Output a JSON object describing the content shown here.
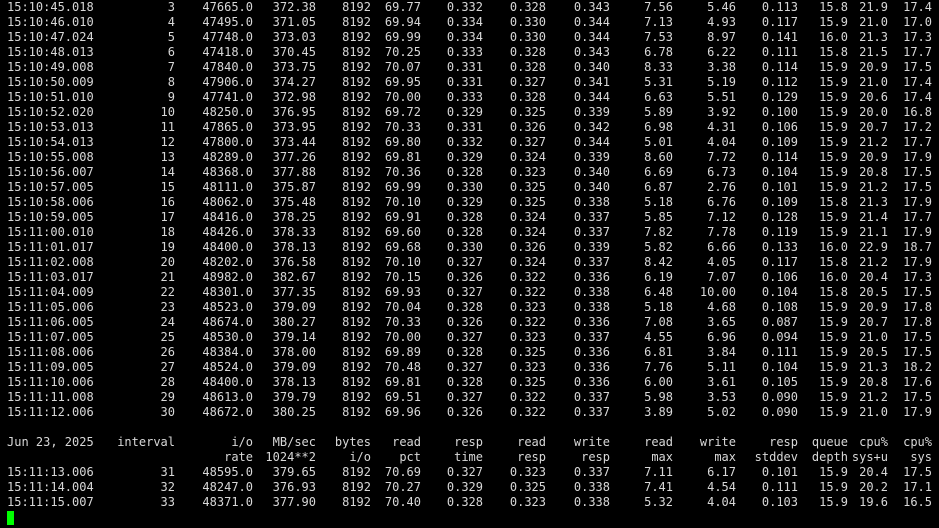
{
  "terminal": {
    "background": "#000000",
    "foreground": "#d8d8d8",
    "cursor_color": "#00ff00"
  },
  "block1": [
    [
      "15:10:45.018",
      "3",
      "47665.0",
      "372.38",
      "8192",
      "69.77",
      "0.332",
      "0.328",
      "0.343",
      "7.56",
      "5.46",
      "0.113",
      "15.8",
      "21.9",
      "17.4"
    ],
    [
      "15:10:46.010",
      "4",
      "47495.0",
      "371.05",
      "8192",
      "69.94",
      "0.334",
      "0.330",
      "0.344",
      "7.13",
      "4.93",
      "0.117",
      "15.9",
      "21.0",
      "17.0"
    ],
    [
      "15:10:47.024",
      "5",
      "47748.0",
      "373.03",
      "8192",
      "69.99",
      "0.334",
      "0.330",
      "0.344",
      "7.53",
      "8.97",
      "0.141",
      "16.0",
      "21.3",
      "17.3"
    ],
    [
      "15:10:48.013",
      "6",
      "47418.0",
      "370.45",
      "8192",
      "70.25",
      "0.333",
      "0.328",
      "0.343",
      "6.78",
      "6.22",
      "0.111",
      "15.8",
      "21.5",
      "17.7"
    ],
    [
      "15:10:49.008",
      "7",
      "47840.0",
      "373.75",
      "8192",
      "70.07",
      "0.331",
      "0.328",
      "0.340",
      "8.33",
      "3.38",
      "0.114",
      "15.9",
      "20.9",
      "17.5"
    ],
    [
      "15:10:50.009",
      "8",
      "47906.0",
      "374.27",
      "8192",
      "69.95",
      "0.331",
      "0.327",
      "0.341",
      "5.31",
      "5.19",
      "0.112",
      "15.9",
      "21.0",
      "17.4"
    ],
    [
      "15:10:51.010",
      "9",
      "47741.0",
      "372.98",
      "8192",
      "70.00",
      "0.333",
      "0.328",
      "0.344",
      "6.63",
      "5.51",
      "0.129",
      "15.9",
      "20.6",
      "17.4"
    ],
    [
      "15:10:52.020",
      "10",
      "48250.0",
      "376.95",
      "8192",
      "69.72",
      "0.329",
      "0.325",
      "0.339",
      "5.89",
      "3.92",
      "0.100",
      "15.9",
      "20.0",
      "16.8"
    ],
    [
      "15:10:53.013",
      "11",
      "47865.0",
      "373.95",
      "8192",
      "70.33",
      "0.331",
      "0.326",
      "0.342",
      "6.98",
      "4.31",
      "0.106",
      "15.9",
      "20.7",
      "17.2"
    ],
    [
      "15:10:54.013",
      "12",
      "47800.0",
      "373.44",
      "8192",
      "69.80",
      "0.332",
      "0.327",
      "0.344",
      "5.01",
      "4.04",
      "0.109",
      "15.9",
      "21.2",
      "17.7"
    ],
    [
      "15:10:55.008",
      "13",
      "48289.0",
      "377.26",
      "8192",
      "69.81",
      "0.329",
      "0.324",
      "0.339",
      "8.60",
      "7.72",
      "0.114",
      "15.9",
      "20.9",
      "17.9"
    ],
    [
      "15:10:56.007",
      "14",
      "48368.0",
      "377.88",
      "8192",
      "70.36",
      "0.328",
      "0.323",
      "0.340",
      "6.69",
      "6.73",
      "0.104",
      "15.9",
      "20.8",
      "17.5"
    ],
    [
      "15:10:57.005",
      "15",
      "48111.0",
      "375.87",
      "8192",
      "69.99",
      "0.330",
      "0.325",
      "0.340",
      "6.87",
      "2.76",
      "0.101",
      "15.9",
      "21.2",
      "17.5"
    ],
    [
      "15:10:58.006",
      "16",
      "48062.0",
      "375.48",
      "8192",
      "70.10",
      "0.329",
      "0.325",
      "0.338",
      "5.18",
      "6.76",
      "0.109",
      "15.8",
      "21.3",
      "17.9"
    ],
    [
      "15:10:59.005",
      "17",
      "48416.0",
      "378.25",
      "8192",
      "69.91",
      "0.328",
      "0.324",
      "0.337",
      "5.85",
      "7.12",
      "0.128",
      "15.9",
      "21.4",
      "17.7"
    ],
    [
      "15:11:00.010",
      "18",
      "48426.0",
      "378.33",
      "8192",
      "69.60",
      "0.328",
      "0.324",
      "0.337",
      "7.82",
      "7.78",
      "0.119",
      "15.9",
      "21.1",
      "17.9"
    ],
    [
      "15:11:01.017",
      "19",
      "48400.0",
      "378.13",
      "8192",
      "69.68",
      "0.330",
      "0.326",
      "0.339",
      "5.82",
      "6.66",
      "0.133",
      "16.0",
      "22.9",
      "18.7"
    ],
    [
      "15:11:02.008",
      "20",
      "48202.0",
      "376.58",
      "8192",
      "70.10",
      "0.327",
      "0.324",
      "0.337",
      "8.42",
      "4.05",
      "0.117",
      "15.8",
      "21.2",
      "17.9"
    ],
    [
      "15:11:03.017",
      "21",
      "48982.0",
      "382.67",
      "8192",
      "70.15",
      "0.326",
      "0.322",
      "0.336",
      "6.19",
      "7.07",
      "0.106",
      "16.0",
      "20.4",
      "17.3"
    ],
    [
      "15:11:04.009",
      "22",
      "48301.0",
      "377.35",
      "8192",
      "69.93",
      "0.327",
      "0.322",
      "0.338",
      "6.48",
      "10.00",
      "0.104",
      "15.8",
      "20.5",
      "17.5"
    ],
    [
      "15:11:05.006",
      "23",
      "48523.0",
      "379.09",
      "8192",
      "70.04",
      "0.328",
      "0.323",
      "0.338",
      "5.18",
      "4.68",
      "0.108",
      "15.9",
      "20.9",
      "17.8"
    ],
    [
      "15:11:06.005",
      "24",
      "48674.0",
      "380.27",
      "8192",
      "70.33",
      "0.326",
      "0.322",
      "0.336",
      "7.08",
      "3.65",
      "0.087",
      "15.9",
      "20.7",
      "17.8"
    ],
    [
      "15:11:07.005",
      "25",
      "48530.0",
      "379.14",
      "8192",
      "70.00",
      "0.327",
      "0.323",
      "0.337",
      "4.55",
      "6.96",
      "0.094",
      "15.9",
      "21.0",
      "17.5"
    ],
    [
      "15:11:08.006",
      "26",
      "48384.0",
      "378.00",
      "8192",
      "69.89",
      "0.328",
      "0.325",
      "0.336",
      "6.81",
      "3.84",
      "0.111",
      "15.9",
      "20.5",
      "17.5"
    ],
    [
      "15:11:09.005",
      "27",
      "48524.0",
      "379.09",
      "8192",
      "70.48",
      "0.327",
      "0.323",
      "0.336",
      "7.76",
      "5.11",
      "0.104",
      "15.9",
      "21.3",
      "18.2"
    ],
    [
      "15:11:10.006",
      "28",
      "48400.0",
      "378.13",
      "8192",
      "69.81",
      "0.328",
      "0.325",
      "0.336",
      "6.00",
      "3.61",
      "0.105",
      "15.9",
      "20.8",
      "17.6"
    ],
    [
      "15:11:11.008",
      "29",
      "48613.0",
      "379.79",
      "8192",
      "69.51",
      "0.327",
      "0.322",
      "0.337",
      "5.98",
      "3.53",
      "0.090",
      "15.9",
      "21.2",
      "17.5"
    ],
    [
      "15:11:12.006",
      "30",
      "48672.0",
      "380.25",
      "8192",
      "69.96",
      "0.326",
      "0.322",
      "0.337",
      "3.89",
      "5.02",
      "0.090",
      "15.9",
      "21.0",
      "17.9"
    ]
  ],
  "header": {
    "line1": [
      "Jun 23, 2025",
      "interval",
      "i/o",
      "MB/sec",
      "bytes",
      "read",
      "resp",
      "read",
      "write",
      "read",
      "write",
      "resp",
      "queue",
      "cpu%",
      "cpu%"
    ],
    "line2": [
      "",
      "",
      "rate",
      "1024**2",
      "i/o",
      "pct",
      "time",
      "resp",
      "resp",
      "max",
      "max",
      "stddev",
      "depth",
      "sys+u",
      "sys"
    ]
  },
  "block2": [
    [
      "15:11:13.006",
      "31",
      "48595.0",
      "379.65",
      "8192",
      "70.69",
      "0.327",
      "0.323",
      "0.337",
      "7.11",
      "6.17",
      "0.101",
      "15.9",
      "20.4",
      "17.5"
    ],
    [
      "15:11:14.004",
      "32",
      "48247.0",
      "376.93",
      "8192",
      "70.27",
      "0.329",
      "0.325",
      "0.338",
      "7.41",
      "4.54",
      "0.111",
      "15.9",
      "20.2",
      "17.1"
    ],
    [
      "15:11:15.007",
      "33",
      "48371.0",
      "377.90",
      "8192",
      "70.40",
      "0.328",
      "0.323",
      "0.338",
      "5.32",
      "4.04",
      "0.103",
      "15.9",
      "19.6",
      "16.5"
    ]
  ]
}
